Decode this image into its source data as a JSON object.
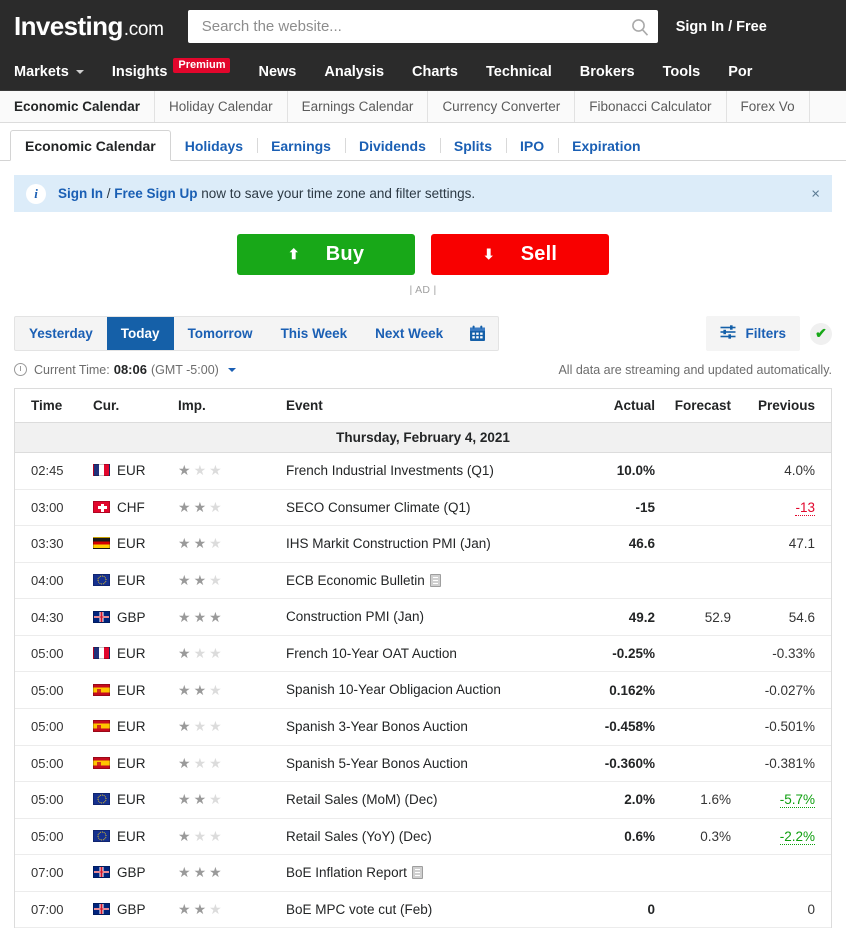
{
  "header": {
    "logo_brand": "Investing",
    "logo_suffix": ".com",
    "search_placeholder": "Search the website...",
    "search_value": "",
    "search_icon": "search-icon",
    "signin_label": "Sign In / Free "
  },
  "mainnav": {
    "items": [
      {
        "label": "Markets",
        "has_caret": true,
        "badge": ""
      },
      {
        "label": "Insights",
        "has_caret": false,
        "badge": "Premium"
      },
      {
        "label": "News",
        "has_caret": false,
        "badge": ""
      },
      {
        "label": "Analysis",
        "has_caret": false,
        "badge": ""
      },
      {
        "label": "Charts",
        "has_caret": false,
        "badge": ""
      },
      {
        "label": "Technical",
        "has_caret": false,
        "badge": ""
      },
      {
        "label": "Brokers",
        "has_caret": false,
        "badge": ""
      },
      {
        "label": "Tools",
        "has_caret": false,
        "badge": ""
      },
      {
        "label": "Por",
        "has_caret": false,
        "badge": ""
      }
    ]
  },
  "subnav": {
    "items": [
      {
        "label": "Economic Calendar",
        "active": true
      },
      {
        "label": "Holiday Calendar",
        "active": false
      },
      {
        "label": "Earnings Calendar",
        "active": false
      },
      {
        "label": "Currency Converter",
        "active": false
      },
      {
        "label": "Fibonacci Calculator",
        "active": false
      },
      {
        "label": "Forex Vo",
        "active": false
      }
    ]
  },
  "tabs": {
    "items": [
      {
        "label": "Economic Calendar",
        "active": true
      },
      {
        "label": "Holidays",
        "active": false
      },
      {
        "label": "Earnings",
        "active": false
      },
      {
        "label": "Dividends",
        "active": false
      },
      {
        "label": "Splits",
        "active": false
      },
      {
        "label": "IPO",
        "active": false
      },
      {
        "label": "Expiration",
        "active": false
      }
    ]
  },
  "notice": {
    "icon": "info-icon",
    "signin_link": "Sign In",
    "separator": " / ",
    "signup_link": "Free Sign Up",
    "rest_text": " now to save your time zone and filter settings.",
    "close_label": "×"
  },
  "ad": {
    "buy_label": "Buy",
    "sell_label": "Sell",
    "buy_arrow": "⬆",
    "sell_arrow": "⬇",
    "ad_tag": "| AD |"
  },
  "daybar": {
    "days": [
      {
        "label": "Yesterday",
        "active": false
      },
      {
        "label": "Today",
        "active": true
      },
      {
        "label": "Tomorrow",
        "active": false
      },
      {
        "label": "This Week",
        "active": false
      },
      {
        "label": "Next Week",
        "active": false
      }
    ],
    "calendar_icon": "calendar-icon",
    "filters_label": "Filters",
    "filters_icon": "sliders-icon",
    "check_icon": "✔"
  },
  "timerow": {
    "clock_icon": "clock-icon",
    "current_time_label": "Current Time:",
    "current_time": "08:06",
    "timezone": "(GMT -5:00)",
    "stream_note": "All data are streaming and updated automatically."
  },
  "table": {
    "columns": [
      "Time",
      "Cur.",
      "Imp.",
      "Event",
      "Actual",
      "Forecast",
      "Previous"
    ],
    "date_header": "Thursday, February 4, 2021",
    "rows": [
      {
        "time": "02:45",
        "flag": "fr",
        "cur": "EUR",
        "stars": 1,
        "event": "French Industrial Investments (Q1)",
        "doc": false,
        "actual": "10.0%",
        "actual_color": "",
        "forecast": "",
        "previous": "4.0%",
        "previous_color": "",
        "previous_link": false
      },
      {
        "time": "03:00",
        "flag": "ch",
        "cur": "CHF",
        "stars": 2,
        "event": "SECO Consumer Climate (Q1)",
        "doc": false,
        "actual": "-15",
        "actual_color": "",
        "forecast": "",
        "previous": "-13",
        "previous_color": "red",
        "previous_link": true
      },
      {
        "time": "03:30",
        "flag": "de",
        "cur": "EUR",
        "stars": 2,
        "event": "IHS Markit Construction PMI (Jan)",
        "doc": false,
        "actual": "46.6",
        "actual_color": "",
        "forecast": "",
        "previous": "47.1",
        "previous_color": "",
        "previous_link": false
      },
      {
        "time": "04:00",
        "flag": "eu",
        "cur": "EUR",
        "stars": 2,
        "event": "ECB Economic Bulletin",
        "doc": true,
        "actual": "",
        "actual_color": "",
        "forecast": "",
        "previous": "",
        "previous_color": "",
        "previous_link": false
      },
      {
        "time": "04:30",
        "flag": "gb",
        "cur": "GBP",
        "stars": 3,
        "event": "Construction PMI (Jan)",
        "doc": false,
        "actual": "49.2",
        "actual_color": "red",
        "forecast": "52.9",
        "previous": "54.6",
        "previous_color": "",
        "previous_link": false
      },
      {
        "time": "05:00",
        "flag": "fr",
        "cur": "EUR",
        "stars": 1,
        "event": "French 10-Year OAT Auction",
        "doc": false,
        "actual": "-0.25%",
        "actual_color": "",
        "forecast": "",
        "previous": "-0.33%",
        "previous_color": "",
        "previous_link": false
      },
      {
        "time": "05:00",
        "flag": "es",
        "cur": "EUR",
        "stars": 2,
        "event": "Spanish 10-Year Obligacion Auction",
        "doc": false,
        "actual": "0.162%",
        "actual_color": "",
        "forecast": "",
        "previous": "-0.027%",
        "previous_color": "",
        "previous_link": false
      },
      {
        "time": "05:00",
        "flag": "es",
        "cur": "EUR",
        "stars": 1,
        "event": "Spanish 3-Year Bonos Auction",
        "doc": false,
        "actual": "-0.458%",
        "actual_color": "",
        "forecast": "",
        "previous": "-0.501%",
        "previous_color": "",
        "previous_link": false
      },
      {
        "time": "05:00",
        "flag": "es",
        "cur": "EUR",
        "stars": 1,
        "event": "Spanish 5-Year Bonos Auction",
        "doc": false,
        "actual": "-0.360%",
        "actual_color": "",
        "forecast": "",
        "previous": "-0.381%",
        "previous_color": "",
        "previous_link": false
      },
      {
        "time": "05:00",
        "flag": "eu",
        "cur": "EUR",
        "stars": 2,
        "event": "Retail Sales (MoM) (Dec)",
        "doc": false,
        "actual": "2.0%",
        "actual_color": "green",
        "forecast": "1.6%",
        "previous": "-5.7%",
        "previous_color": "green",
        "previous_link": true
      },
      {
        "time": "05:00",
        "flag": "eu",
        "cur": "EUR",
        "stars": 1,
        "event": "Retail Sales (YoY) (Dec)",
        "doc": false,
        "actual": "0.6%",
        "actual_color": "green",
        "forecast": "0.3%",
        "previous": "-2.2%",
        "previous_color": "green",
        "previous_link": true
      },
      {
        "time": "07:00",
        "flag": "gb",
        "cur": "GBP",
        "stars": 3,
        "event": "BoE Inflation Report",
        "doc": true,
        "actual": "",
        "actual_color": "",
        "forecast": "",
        "previous": "",
        "previous_color": "",
        "previous_link": false
      },
      {
        "time": "07:00",
        "flag": "gb",
        "cur": "GBP",
        "stars": 2,
        "event": "BoE MPC vote cut (Feb)",
        "doc": false,
        "actual": "0",
        "actual_color": "",
        "forecast": "",
        "previous": "0",
        "previous_color": "",
        "previous_link": false
      }
    ]
  },
  "colors": {
    "brand_dark": "#2b2b2b",
    "link_blue": "#1a5fb4",
    "active_blue": "#1560a8",
    "up_green": "#0e9f0e",
    "down_red": "#e2062c"
  }
}
